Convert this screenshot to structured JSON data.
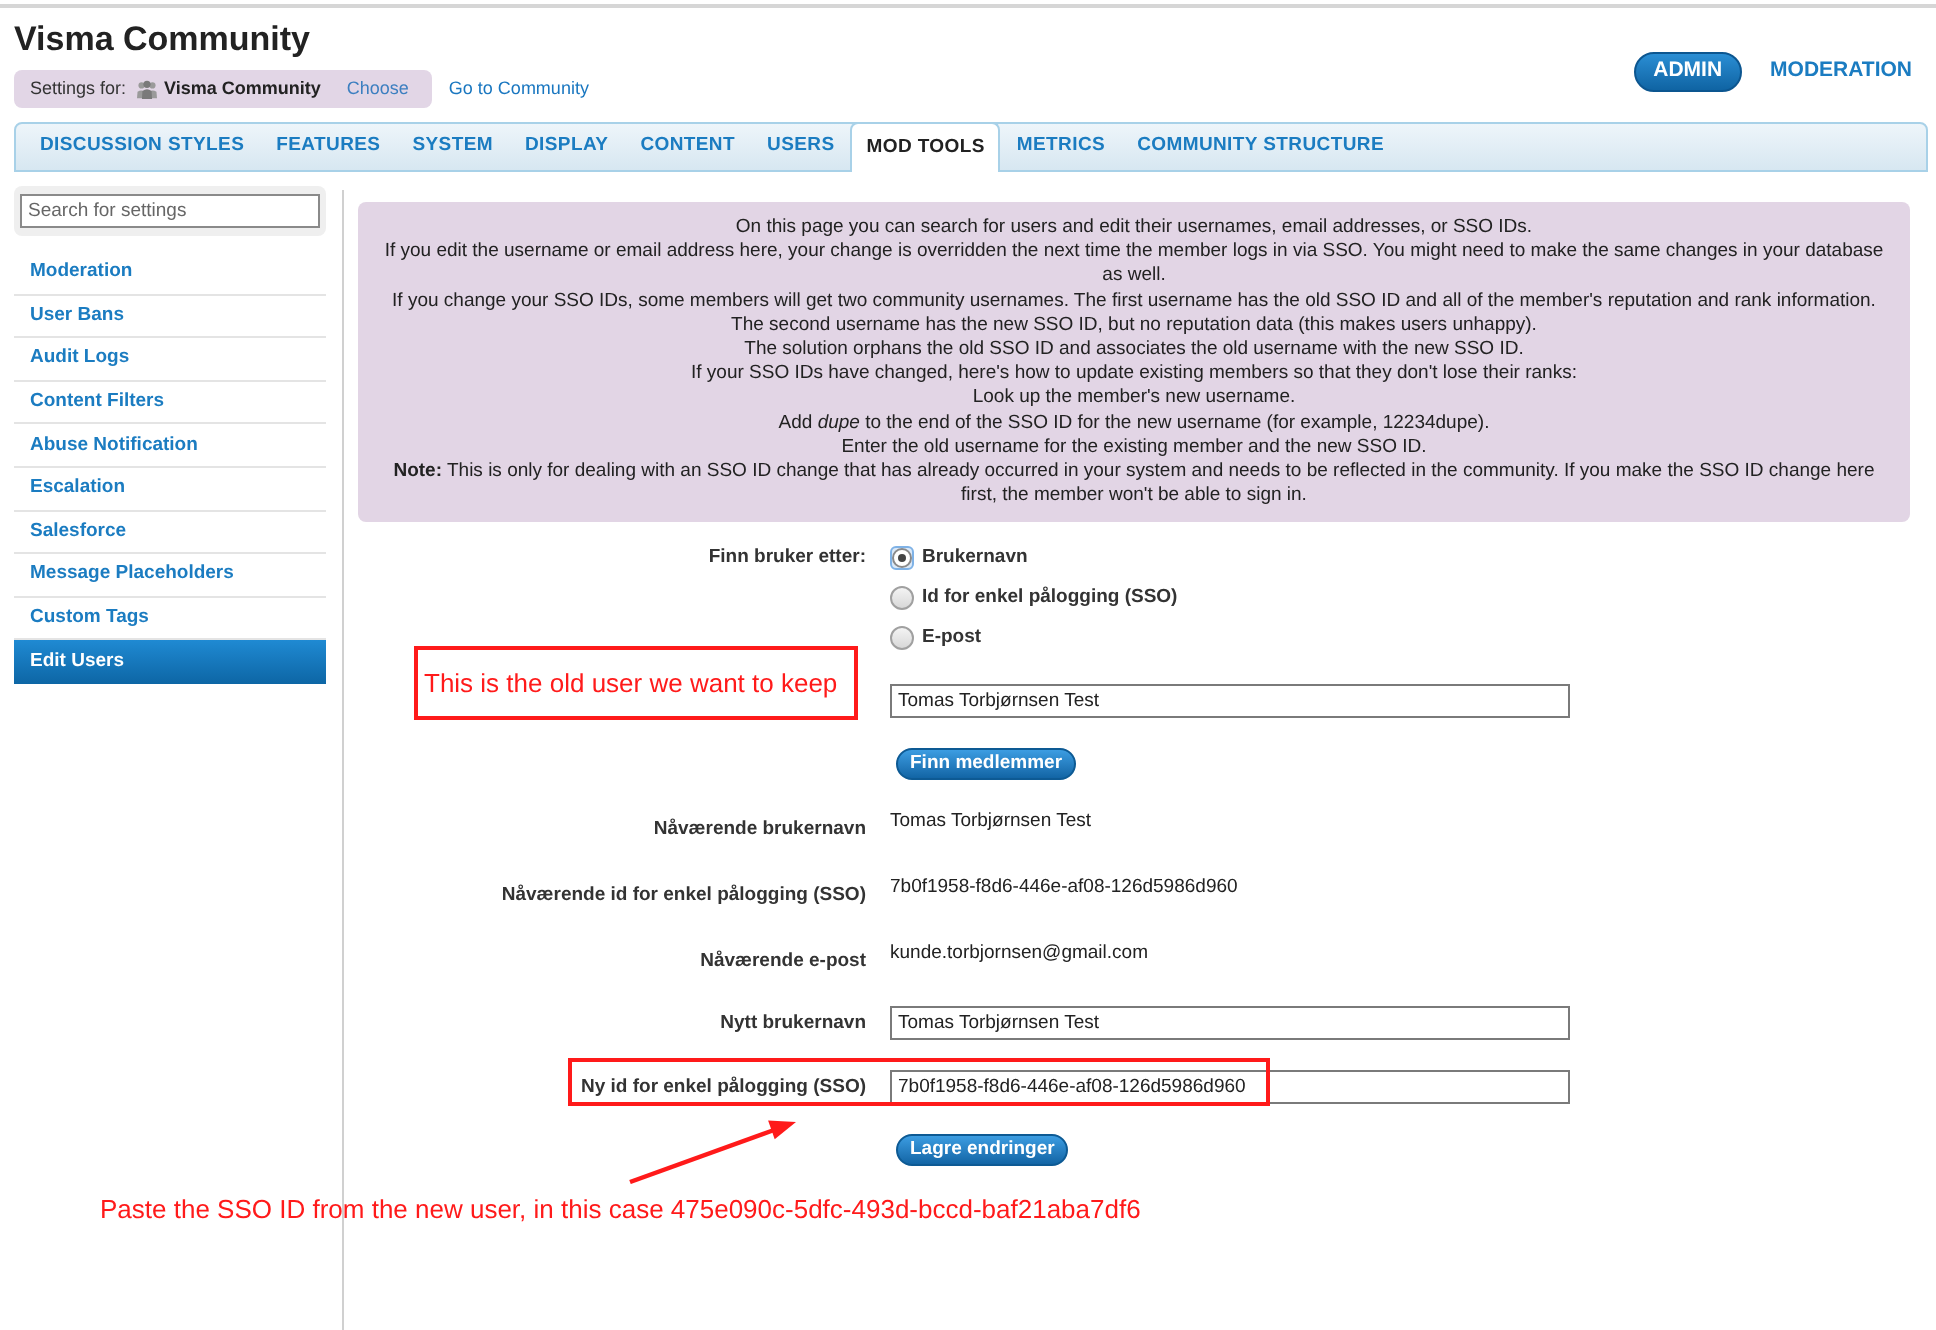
{
  "header": {
    "title": "Visma Community",
    "settings_for": {
      "label": "Settings for:",
      "community": "Visma Community",
      "choose": "Choose"
    },
    "go_to_community": "Go to Community",
    "nav": [
      {
        "label": "ADMIN",
        "selected": true
      },
      {
        "label": "MODERATION",
        "selected": false
      }
    ]
  },
  "tabs": [
    {
      "label": "DISCUSSION STYLES",
      "selected": false
    },
    {
      "label": "FEATURES",
      "selected": false
    },
    {
      "label": "SYSTEM",
      "selected": false
    },
    {
      "label": "DISPLAY",
      "selected": false
    },
    {
      "label": "CONTENT",
      "selected": false
    },
    {
      "label": "USERS",
      "selected": false
    },
    {
      "label": "MOD TOOLS",
      "selected": true
    },
    {
      "label": "METRICS",
      "selected": false
    },
    {
      "label": "COMMUNITY STRUCTURE",
      "selected": false
    }
  ],
  "sidebar": {
    "search": {
      "placeholder": "Search for settings"
    },
    "items": [
      {
        "label": "Moderation",
        "selected": false
      },
      {
        "label": "User Bans",
        "selected": false
      },
      {
        "label": "Audit Logs",
        "selected": false
      },
      {
        "label": "Content Filters",
        "selected": false
      },
      {
        "label": "Abuse Notification",
        "selected": false
      },
      {
        "label": "Escalation",
        "selected": false
      },
      {
        "label": "Salesforce",
        "selected": false
      },
      {
        "label": "Message Placeholders",
        "selected": false
      },
      {
        "label": "Custom Tags",
        "selected": false
      },
      {
        "label": "Edit Users",
        "selected": true
      }
    ]
  },
  "info": {
    "paragraphs": [
      "On this page you can search for users and edit their usernames, email addresses, or SSO IDs.",
      "If you edit the username or email address here, your change is overridden the next time the member logs in via SSO. You might need to make the same changes in your database as well.",
      "If you change your SSO IDs, some members will get two community usernames. The first username has the old SSO ID and all of the member's reputation and rank information.",
      "The second username has the new SSO ID, but no reputation data (this makes users unhappy).",
      "The solution orphans the old SSO ID and associates the old username with the new SSO ID.",
      "If your SSO IDs have changed, here's how to update existing members so that they don't lose their ranks:",
      "Look up the member's new username.",
      "Add *dupe* to the end of the SSO ID for the new username (for example, 12234dupe).",
      "Enter the old username for the existing member and the new SSO ID.",
      "**Note:** This is only for dealing with an SSO ID change that has already occurred in your system and needs to be reflected in the community. If you make the SSO ID change here first, the member won't be able to sign in."
    ]
  },
  "form": {
    "search_by": {
      "label": "Finn bruker etter:",
      "options": [
        {
          "label": "Brukernavn",
          "selected": true
        },
        {
          "label": "Id for enkel pålogging (SSO)",
          "selected": false
        },
        {
          "label": "E-post",
          "selected": false
        }
      ]
    },
    "search_field": {
      "value": "Tomas Torbjørnsen Test"
    },
    "find_button": "Finn medlemmer",
    "fields": [
      {
        "kind": "text",
        "label": "Nåværende brukernavn",
        "value": "Tomas Torbjørnsen Test"
      },
      {
        "kind": "text",
        "label": "Nåværende id for enkel pålogging (SSO)",
        "value": "7b0f1958-f8d6-446e-af08-126d5986d960"
      },
      {
        "kind": "text",
        "label": "Nåværende e-post",
        "value": "kunde.torbjornsen@gmail.com"
      },
      {
        "kind": "input",
        "label": "Nytt brukernavn",
        "value": "Tomas Torbjørnsen Test"
      },
      {
        "kind": "input",
        "label": "Ny id for enkel pålogging (SSO)",
        "value": "7b0f1958-f8d6-446e-af08-126d5986d960"
      }
    ],
    "save_button": "Lagre endringer"
  },
  "annotations": [
    {
      "kind": "boxed_note",
      "text": "This is the old user we want to keep"
    },
    {
      "kind": "highlight_box"
    },
    {
      "kind": "arrow"
    },
    {
      "kind": "note",
      "text": "Paste the SSO ID from the new user, in this case 475e090c-5dfc-493d-bccd-baf21aba7df6"
    }
  ]
}
